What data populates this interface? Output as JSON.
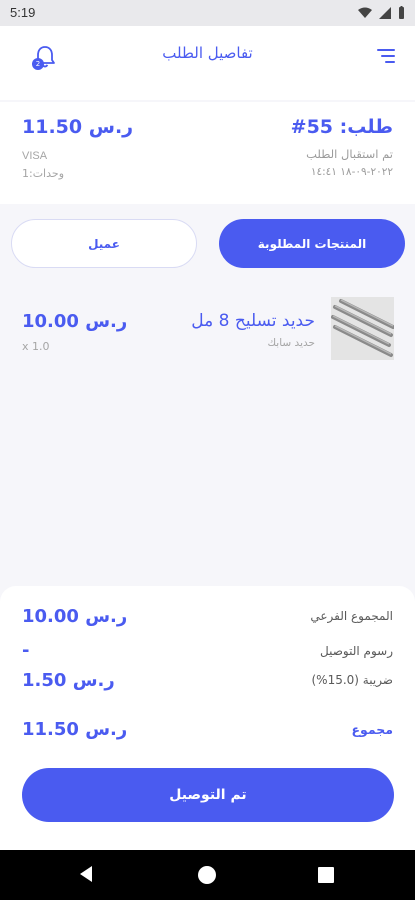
{
  "status_bar": {
    "time": "5:19"
  },
  "app_bar": {
    "title": "تفاصيل الطلب",
    "notification_count": "2"
  },
  "order": {
    "number": "طلب: 55#",
    "received_label": "تم استقبال الطلب",
    "date": "٢٠٢٢-٠٩-١٨ ١٤:٤١",
    "total_amount": "11.50",
    "total_currency": "ر.س",
    "payment_method": "VISA",
    "units": "وحدات:1"
  },
  "tabs": [
    {
      "label": "المنتجات المطلوبة",
      "active": true
    },
    {
      "label": "عميل",
      "active": false
    }
  ],
  "products": [
    {
      "name": "حديد تسليح 8 مل",
      "subtitle": "حديد سابك",
      "price": "10.00",
      "currency": "ر.س",
      "quantity": "x 1.0",
      "image_icon": "rebar-image"
    }
  ],
  "summary": {
    "subtotal_label": "المجموع الفرعي",
    "subtotal_value": "10.00",
    "subtotal_currency": "ر.س",
    "delivery_label": "رسوم التوصيل",
    "delivery_value": "-",
    "tax_label": "ضريبة (15.0%)",
    "tax_value": "1.50",
    "tax_currency": "ر.س",
    "total_label": "مجموع",
    "total_value": "11.50",
    "total_currency": "ر.س"
  },
  "action_button": {
    "label": "تم التوصيل"
  },
  "colors": {
    "accent": "#4a5bf0",
    "background": "#f6f6fa"
  }
}
